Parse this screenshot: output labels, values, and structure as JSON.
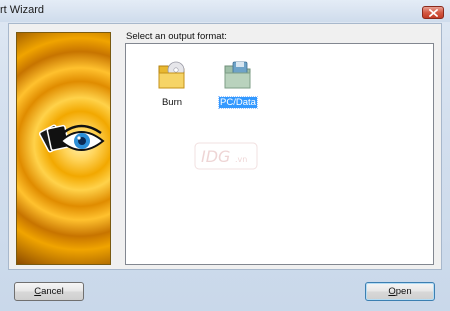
{
  "window": {
    "title": "rt Wizard"
  },
  "content": {
    "section_label": "Select an output format:",
    "formats": [
      {
        "label": "Burn",
        "icon": "folder-cd-icon",
        "selected": false
      },
      {
        "label": "PC/Data",
        "icon": "folder-floppy-icon",
        "selected": true
      }
    ]
  },
  "buttons": {
    "cancel": {
      "mnemonic": "C",
      "rest": "ancel"
    },
    "open": {
      "mnemonic": "O",
      "rest": "pen"
    }
  },
  "colors": {
    "selection": "#3399ff",
    "banner": "#f2a800"
  }
}
